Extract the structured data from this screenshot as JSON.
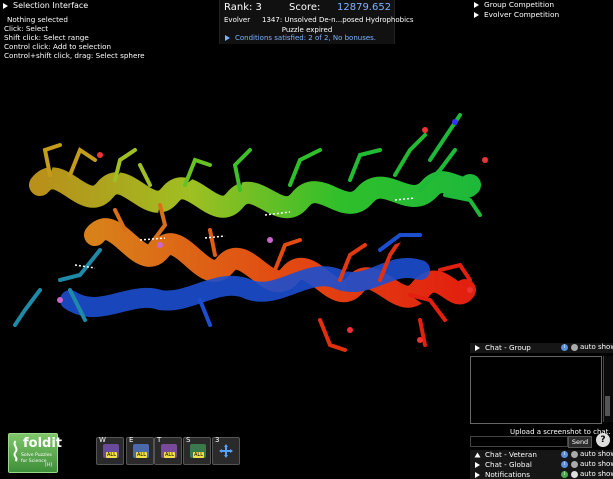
{
  "selection_interface": {
    "title": "Selection Interface",
    "lines": [
      "Nothing selected",
      "Click: Select",
      "Shift click: Select range",
      "Control click: Add to selection",
      "Control+shift click, drag: Select sphere"
    ]
  },
  "score_panel": {
    "rank_label": "Rank: 3",
    "score_label": "Score:",
    "score_value": "12879.652",
    "player": "Evolver",
    "puzzle": "1347: Unsolved De-n...posed Hydrophobics",
    "status": "Puzzle expired",
    "conditions": "Conditions satisfied: 2 of 2, No bonuses."
  },
  "competitions": [
    "Group Competition",
    "Evolver Competition"
  ],
  "logo": {
    "name": "foldit",
    "tagline1": "Solve Puzzles",
    "tagline2": "for Science",
    "hotkey": "[H]"
  },
  "tools": [
    {
      "key": "W",
      "icon": "wiggle-all-icon",
      "badge": "ALL",
      "color": "#6a4a9a"
    },
    {
      "key": "E",
      "icon": "shake-all-icon",
      "badge": "ALL",
      "color": "#4a6aaa"
    },
    {
      "key": "T",
      "icon": "tweak-all-icon",
      "badge": "ALL",
      "color": "#7a4a9a"
    },
    {
      "key": "S",
      "icon": "sidechains-all-icon",
      "badge": "ALL",
      "color": "#3a7a4a"
    },
    {
      "key": "3",
      "icon": "move-icon",
      "badge": "",
      "color": "#3a6ab0"
    }
  ],
  "chat": {
    "group": "Chat - Group",
    "veteran": "Chat - Veteran",
    "global": "Chat - Global",
    "notifications": "Notifications",
    "auto_show": "auto show",
    "upload_text": "Upload a screenshot to chat.",
    "send": "Send",
    "help": "?"
  }
}
